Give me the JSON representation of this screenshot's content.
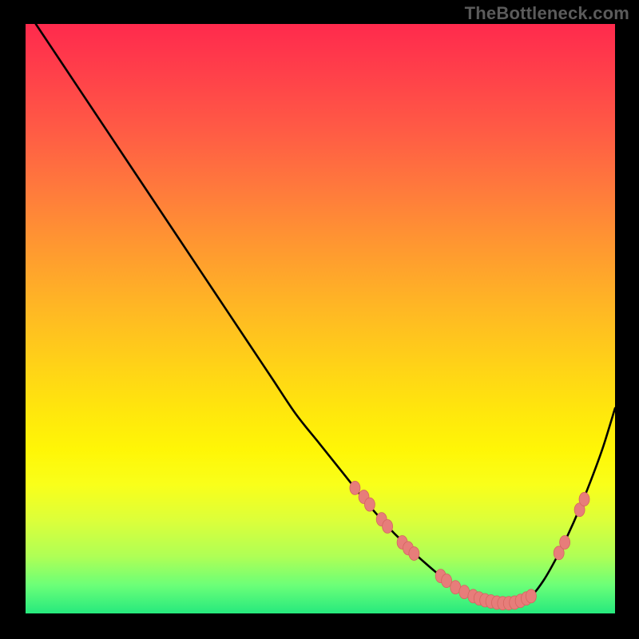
{
  "watermark": "TheBottleneck.com",
  "colors": {
    "curve": "#000000",
    "marker_fill": "#e77d7a",
    "marker_stroke": "#d46560",
    "bg_top": "#ff2a4d",
    "bg_bottom": "#22e87e"
  },
  "chart_data": {
    "type": "line",
    "title": "",
    "xlabel": "",
    "ylabel": "",
    "xlim": [
      0,
      100
    ],
    "ylim": [
      0,
      100
    ],
    "x": [
      2,
      6,
      10,
      14,
      18,
      22,
      26,
      30,
      34,
      38,
      42,
      46,
      50,
      54,
      58,
      62,
      64,
      66,
      68,
      70,
      72,
      74,
      76,
      78,
      80,
      82,
      84,
      86,
      88,
      90,
      92,
      94,
      96,
      98,
      100
    ],
    "values": [
      100,
      94,
      88,
      82,
      76,
      70,
      64,
      58,
      52,
      46,
      40,
      34,
      29,
      24,
      19,
      14.5,
      12.5,
      10.5,
      8.7,
      7.0,
      5.5,
      4.3,
      3.4,
      2.7,
      2.2,
      2.0,
      2.3,
      3.4,
      6.0,
      9.5,
      13.5,
      18.0,
      23.0,
      28.5,
      35.0
    ],
    "markers": [
      {
        "x": 56.0,
        "y": 21.5
      },
      {
        "x": 57.5,
        "y": 20.0
      },
      {
        "x": 58.5,
        "y": 18.7
      },
      {
        "x": 60.5,
        "y": 16.2
      },
      {
        "x": 61.5,
        "y": 15.0
      },
      {
        "x": 64.0,
        "y": 12.3
      },
      {
        "x": 65.0,
        "y": 11.3
      },
      {
        "x": 66.0,
        "y": 10.4
      },
      {
        "x": 70.5,
        "y": 6.6
      },
      {
        "x": 71.5,
        "y": 5.8
      },
      {
        "x": 73.0,
        "y": 4.7
      },
      {
        "x": 74.5,
        "y": 3.9
      },
      {
        "x": 76.0,
        "y": 3.2
      },
      {
        "x": 77.0,
        "y": 2.8
      },
      {
        "x": 78.0,
        "y": 2.5
      },
      {
        "x": 79.0,
        "y": 2.3
      },
      {
        "x": 80.0,
        "y": 2.1
      },
      {
        "x": 81.0,
        "y": 2.0
      },
      {
        "x": 82.0,
        "y": 2.0
      },
      {
        "x": 83.0,
        "y": 2.1
      },
      {
        "x": 84.0,
        "y": 2.4
      },
      {
        "x": 85.0,
        "y": 2.8
      },
      {
        "x": 85.8,
        "y": 3.2
      },
      {
        "x": 90.5,
        "y": 10.5
      },
      {
        "x": 91.5,
        "y": 12.3
      },
      {
        "x": 94.0,
        "y": 17.8
      },
      {
        "x": 94.8,
        "y": 19.6
      }
    ]
  }
}
